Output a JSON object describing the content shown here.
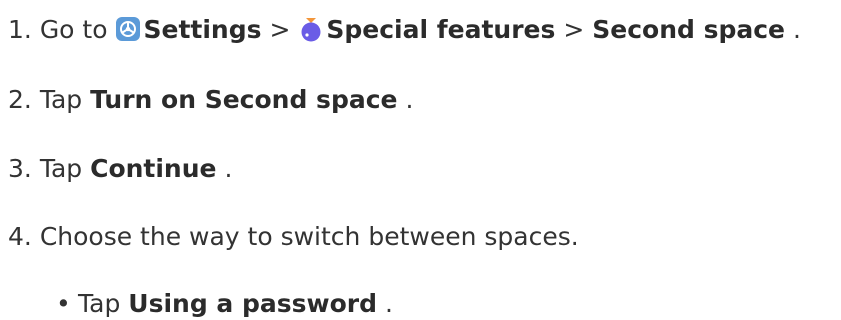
{
  "steps": [
    {
      "number": "1.",
      "text": "Go to",
      "path": [
        {
          "icon": "settings-icon",
          "label": "Settings"
        },
        {
          "icon": "special-features-icon",
          "label": "Special features"
        },
        {
          "label": "Second space"
        }
      ],
      "separator": ">",
      "end": "."
    },
    {
      "number": "2.",
      "text": "Tap",
      "target": "Turn on Second space",
      "end": "."
    },
    {
      "number": "3.",
      "text": "Tap",
      "target": "Continue",
      "end": "."
    },
    {
      "number": "4.",
      "text": "Choose the way to switch between spaces."
    }
  ],
  "substeps": [
    {
      "bullet": "•",
      "text": "Tap",
      "target": "Using a password",
      "end": "."
    }
  ],
  "colors": {
    "settings_icon_bg": "#5b9ad8",
    "special_features_icon": "#6a5ce6",
    "special_features_icon_top": "#f3963a"
  }
}
